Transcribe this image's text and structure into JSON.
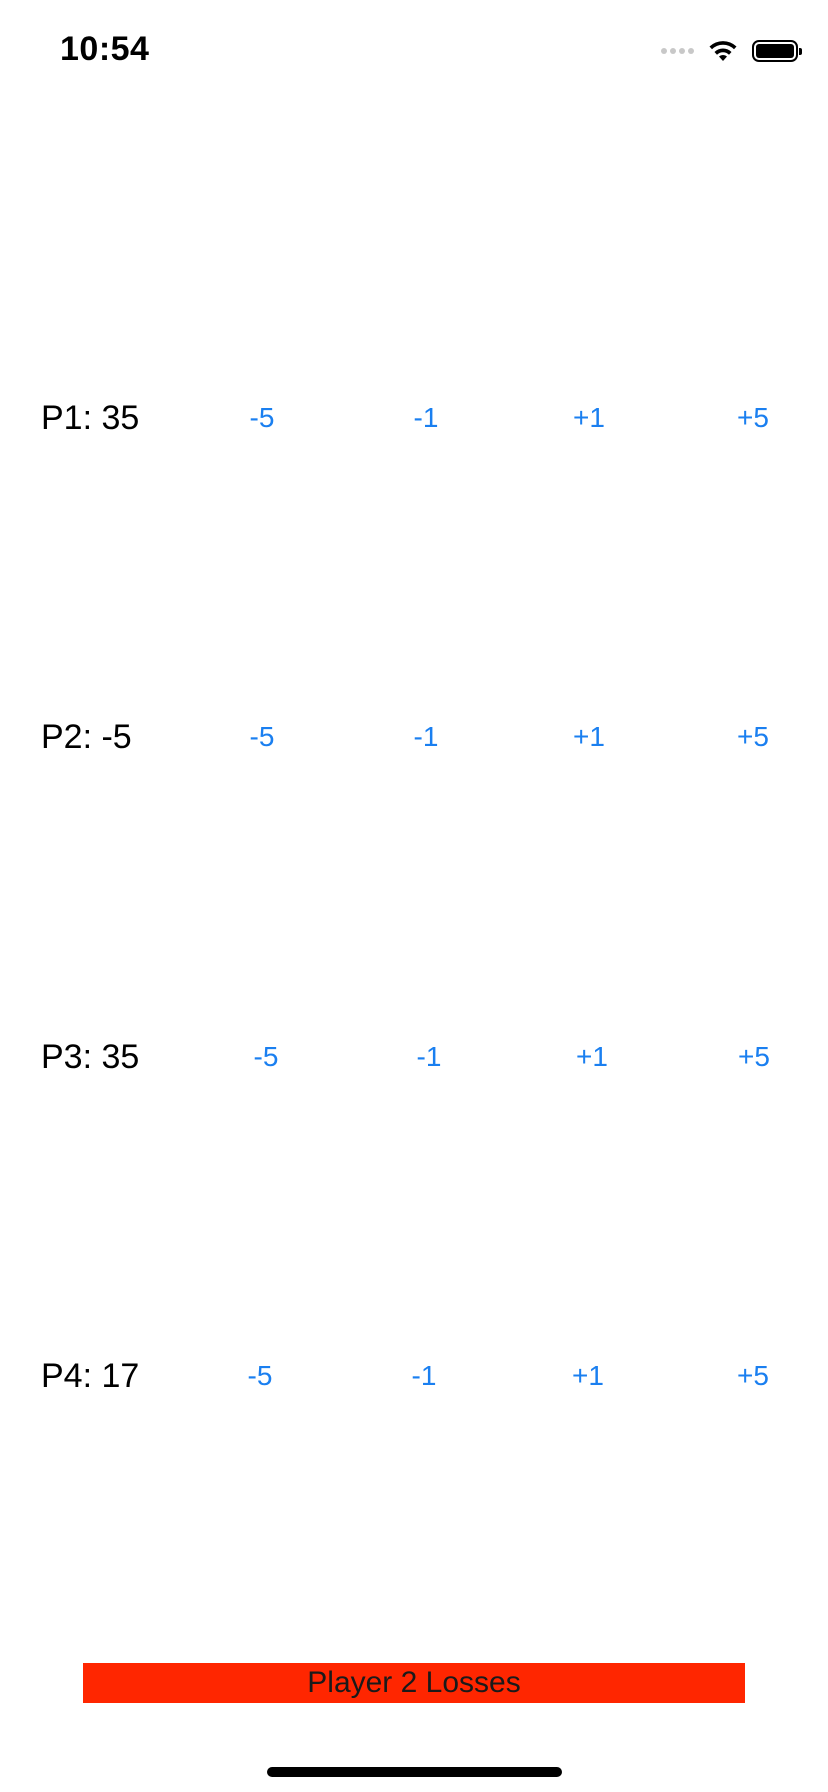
{
  "status_bar": {
    "time": "10:54"
  },
  "players": [
    {
      "label": "P1: 35",
      "buttons": [
        "-5",
        "-1",
        "+1",
        "+5"
      ]
    },
    {
      "label": "P2: -5",
      "buttons": [
        "-5",
        "-1",
        "+1",
        "+5"
      ]
    },
    {
      "label": "P3: 35",
      "buttons": [
        "-5",
        "-1",
        "+1",
        "+5"
      ]
    },
    {
      "label": "P4: 17",
      "buttons": [
        "-5",
        "-1",
        "+1",
        "+5"
      ]
    }
  ],
  "banner": {
    "text": "Player 2 Losses"
  },
  "colors": {
    "button_text": "#1a7ff0",
    "banner_background": "#ff2600"
  },
  "icons": {
    "status": [
      "cellular-signal-icon",
      "wifi-icon",
      "battery-icon"
    ]
  }
}
